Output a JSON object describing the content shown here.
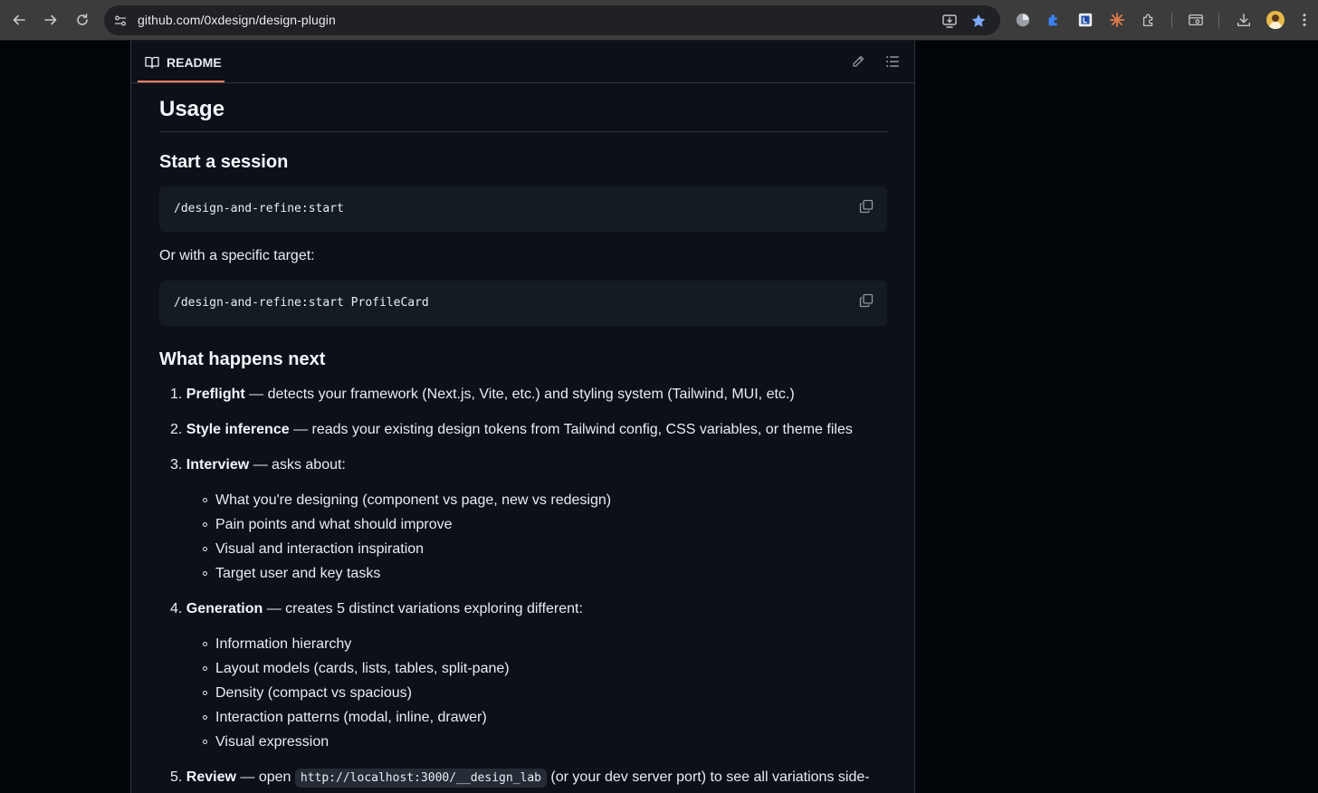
{
  "browser": {
    "url": "github.com/0xdesign/design-plugin"
  },
  "readme": {
    "tab_label": "README",
    "h2": "Usage",
    "start_heading": "Start a session",
    "code1": "/design-and-refine:start",
    "or_text": "Or with a specific target:",
    "code2": "/design-and-refine:start ProfileCard",
    "next_heading": "What happens next",
    "steps": [
      {
        "num": "1.",
        "title": "Preflight",
        "rest": " — detects your framework (Next.js, Vite, etc.) and styling system (Tailwind, MUI, etc.)"
      },
      {
        "num": "2.",
        "title": "Style inference",
        "rest": " — reads your existing design tokens from Tailwind config, CSS variables, or theme files"
      },
      {
        "num": "3.",
        "title": "Interview",
        "rest": " — asks about:"
      },
      {
        "num": "4.",
        "title": "Generation",
        "rest": " — creates 5 distinct variations exploring different:"
      },
      {
        "num": "5.",
        "title": "Review",
        "rest_before": " — open ",
        "code": "http://localhost:3000/__design_lab",
        "rest_after": " (or your dev server port) to see all variations side-"
      }
    ],
    "interview_items": [
      "What you're designing (component vs page, new vs redesign)",
      "Pain points and what should improve",
      "Visual and interaction inspiration",
      "Target user and key tasks"
    ],
    "generation_items": [
      "Information hierarchy",
      "Layout models (cards, lists, tables, split-pane)",
      "Density (compact vs spacious)",
      "Interaction patterns (modal, inline, drawer)",
      "Visual expression"
    ]
  }
}
